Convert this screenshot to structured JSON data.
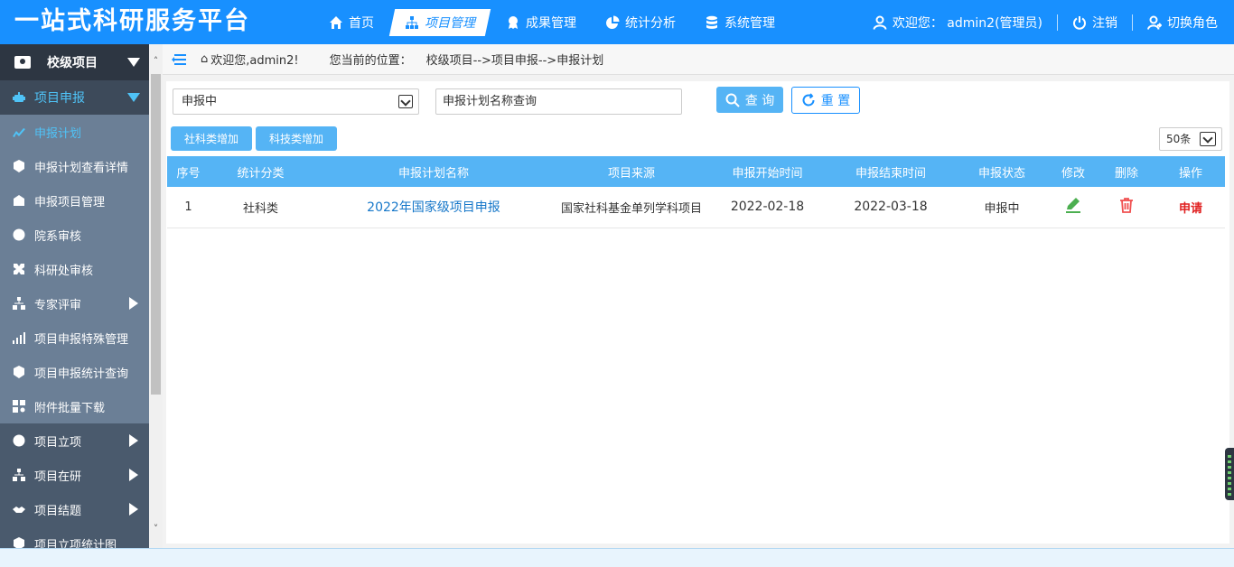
{
  "header": {
    "logo": "一站式科研服务平台",
    "nav": [
      {
        "label": "首页",
        "icon": "home-icon"
      },
      {
        "label": "项目管理",
        "icon": "sitemap-icon",
        "active": true
      },
      {
        "label": "成果管理",
        "icon": "award-icon"
      },
      {
        "label": "统计分析",
        "icon": "pie-chart-icon"
      },
      {
        "label": "系统管理",
        "icon": "database-icon"
      }
    ],
    "welcome": "欢迎您：  admin2(管理员)",
    "logout": "注销",
    "switch_role": "切换角色"
  },
  "sidebar": {
    "top": "校级项目",
    "group": "项目申报",
    "items": [
      "申报计划",
      "申报计划查看详情",
      "申报项目管理",
      "院系审核",
      "科研处审核",
      "专家评审",
      "项目申报特殊管理",
      "项目申报统计查询",
      "附件批量下载",
      "项目立项",
      "项目在研",
      "项目结题",
      "项目立项统计图"
    ]
  },
  "breadcrumb": {
    "welcome": "欢迎您,admin2!",
    "location_label": "您当前的位置：",
    "path": "校级项目-->项目申报-->申报计划"
  },
  "filters": {
    "status_selected": "申报中",
    "name_placeholder": "申报计划名称查询",
    "query_label": "查 询",
    "reset_label": "重 置"
  },
  "actions": {
    "add_social": "社科类增加",
    "add_tech": "科技类增加",
    "page_size": "50条"
  },
  "table": {
    "headers": [
      "序号",
      "统计分类",
      "申报计划名称",
      "项目来源",
      "申报开始时间",
      "申报结束时间",
      "申报状态",
      "修改",
      "删除",
      "操作"
    ],
    "rows": [
      {
        "index": "1",
        "category": "社科类",
        "name": "2022年国家级项目申报",
        "source": "国家社科基金单列学科项目",
        "start": "2022-02-18",
        "end": "2022-03-18",
        "status": "申报中",
        "action": "申请"
      }
    ]
  }
}
